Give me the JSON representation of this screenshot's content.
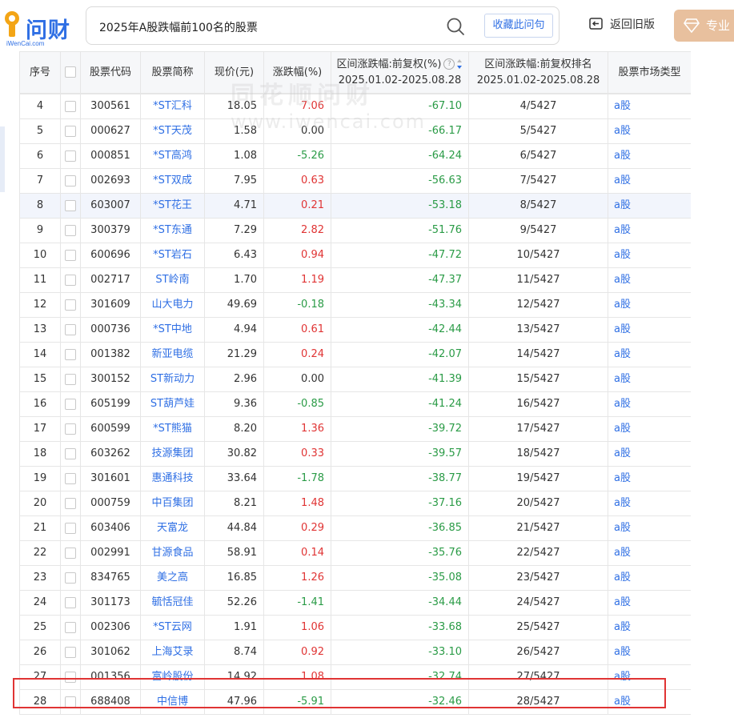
{
  "logo": {
    "text": "问财",
    "sub": "iWenCai.com"
  },
  "search": {
    "query": "2025年A股跌幅前100名的股票",
    "icon": "search-icon"
  },
  "collect_label": "收藏此问句",
  "back_label": "返回旧版",
  "pro_label": "专业",
  "watermark": {
    "line1": "同花顺问财",
    "line2": "www.iwencai.com"
  },
  "colors": {
    "accent": "#2f6fe4",
    "up": "#e03434",
    "down": "#2a9b46",
    "pro": "#e8c09e",
    "highlight": "#e03434"
  },
  "table": {
    "headers": {
      "idx": "序号",
      "code": "股票代码",
      "name": "股票简称",
      "price": "现价(元)",
      "change": "涨跌幅(%)",
      "range_change_l1": "区间涨跌幅:前复权(%)",
      "range_change_l2": "2025.01.02-2025.08.28",
      "range_rank_l1": "区间涨跌幅:前复权排名",
      "range_rank_l2": "2025.01.02-2025.08.28",
      "type": "股票市场类型"
    },
    "rows": [
      {
        "idx": "4",
        "code": "300561",
        "name": "*ST汇科",
        "price": "18.05",
        "change": "7.06",
        "range": "-67.10",
        "rank": "4/5427",
        "type": "a股"
      },
      {
        "idx": "5",
        "code": "000627",
        "name": "*ST天茂",
        "price": "1.58",
        "change": "0.00",
        "range": "-66.17",
        "rank": "5/5427",
        "type": "a股"
      },
      {
        "idx": "6",
        "code": "000851",
        "name": "*ST高鸿",
        "price": "1.08",
        "change": "-5.26",
        "range": "-64.24",
        "rank": "6/5427",
        "type": "a股"
      },
      {
        "idx": "7",
        "code": "002693",
        "name": "*ST双成",
        "price": "7.95",
        "change": "0.63",
        "range": "-56.63",
        "rank": "7/5427",
        "type": "a股"
      },
      {
        "idx": "8",
        "code": "603007",
        "name": "*ST花王",
        "price": "4.71",
        "change": "0.21",
        "range": "-53.18",
        "rank": "8/5427",
        "type": "a股"
      },
      {
        "idx": "9",
        "code": "300379",
        "name": "*ST东通",
        "price": "7.29",
        "change": "2.82",
        "range": "-51.76",
        "rank": "9/5427",
        "type": "a股"
      },
      {
        "idx": "10",
        "code": "600696",
        "name": "*ST岩石",
        "price": "6.43",
        "change": "0.94",
        "range": "-47.72",
        "rank": "10/5427",
        "type": "a股"
      },
      {
        "idx": "11",
        "code": "002717",
        "name": "ST岭南",
        "price": "1.70",
        "change": "1.19",
        "range": "-47.37",
        "rank": "11/5427",
        "type": "a股"
      },
      {
        "idx": "12",
        "code": "301609",
        "name": "山大电力",
        "price": "49.69",
        "change": "-0.18",
        "range": "-43.34",
        "rank": "12/5427",
        "type": "a股"
      },
      {
        "idx": "13",
        "code": "000736",
        "name": "*ST中地",
        "price": "4.94",
        "change": "0.61",
        "range": "-42.44",
        "rank": "13/5427",
        "type": "a股"
      },
      {
        "idx": "14",
        "code": "001382",
        "name": "新亚电缆",
        "price": "21.29",
        "change": "0.24",
        "range": "-42.07",
        "rank": "14/5427",
        "type": "a股"
      },
      {
        "idx": "15",
        "code": "300152",
        "name": "ST新动力",
        "price": "2.96",
        "change": "0.00",
        "range": "-41.39",
        "rank": "15/5427",
        "type": "a股"
      },
      {
        "idx": "16",
        "code": "605199",
        "name": "ST葫芦娃",
        "price": "9.36",
        "change": "-0.85",
        "range": "-41.24",
        "rank": "16/5427",
        "type": "a股"
      },
      {
        "idx": "17",
        "code": "600599",
        "name": "*ST熊猫",
        "price": "8.20",
        "change": "1.36",
        "range": "-39.72",
        "rank": "17/5427",
        "type": "a股"
      },
      {
        "idx": "18",
        "code": "603262",
        "name": "技源集团",
        "price": "30.82",
        "change": "0.33",
        "range": "-39.57",
        "rank": "18/5427",
        "type": "a股"
      },
      {
        "idx": "19",
        "code": "301601",
        "name": "惠通科技",
        "price": "33.64",
        "change": "-1.78",
        "range": "-38.77",
        "rank": "19/5427",
        "type": "a股"
      },
      {
        "idx": "20",
        "code": "000759",
        "name": "中百集团",
        "price": "8.21",
        "change": "1.48",
        "range": "-37.16",
        "rank": "20/5427",
        "type": "a股"
      },
      {
        "idx": "21",
        "code": "603406",
        "name": "天富龙",
        "price": "44.84",
        "change": "0.29",
        "range": "-36.85",
        "rank": "21/5427",
        "type": "a股"
      },
      {
        "idx": "22",
        "code": "002991",
        "name": "甘源食品",
        "price": "58.91",
        "change": "0.14",
        "range": "-35.76",
        "rank": "22/5427",
        "type": "a股"
      },
      {
        "idx": "23",
        "code": "834765",
        "name": "美之高",
        "price": "16.85",
        "change": "1.26",
        "range": "-35.08",
        "rank": "23/5427",
        "type": "a股"
      },
      {
        "idx": "24",
        "code": "301173",
        "name": "毓恬冠佳",
        "price": "52.26",
        "change": "-1.41",
        "range": "-34.44",
        "rank": "24/5427",
        "type": "a股"
      },
      {
        "idx": "25",
        "code": "002306",
        "name": "*ST云网",
        "price": "1.91",
        "change": "1.06",
        "range": "-33.68",
        "rank": "25/5427",
        "type": "a股"
      },
      {
        "idx": "26",
        "code": "301062",
        "name": "上海艾录",
        "price": "8.74",
        "change": "0.92",
        "range": "-33.10",
        "rank": "26/5427",
        "type": "a股"
      },
      {
        "idx": "27",
        "code": "001356",
        "name": "富岭股份",
        "price": "14.92",
        "change": "1.08",
        "range": "-32.74",
        "rank": "27/5427",
        "type": "a股"
      },
      {
        "idx": "28",
        "code": "688408",
        "name": "中信博",
        "price": "47.96",
        "change": "-5.91",
        "range": "-32.46",
        "rank": "28/5427",
        "type": "a股"
      }
    ]
  }
}
